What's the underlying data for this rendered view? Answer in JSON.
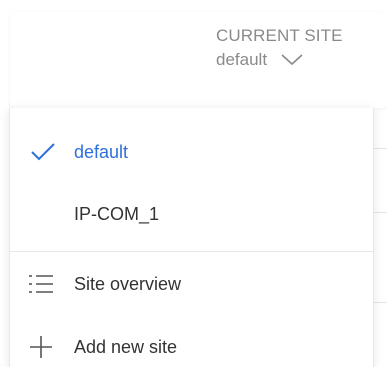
{
  "site_selector": {
    "title": "CURRENT SITE",
    "value": "default",
    "chevron_icon": "chevron-down-icon"
  },
  "dropdown": {
    "sites": [
      {
        "label": "default",
        "selected": true,
        "icon": "check-icon"
      },
      {
        "label": "IP-COM_1",
        "selected": false
      }
    ],
    "actions": [
      {
        "label": "Site overview",
        "icon": "list-icon"
      },
      {
        "label": "Add new site",
        "icon": "plus-icon"
      }
    ]
  },
  "colors": {
    "accent": "#2d6fde",
    "text": "#333333",
    "muted": "#8a8a8a",
    "divider": "#e8e8e8"
  }
}
